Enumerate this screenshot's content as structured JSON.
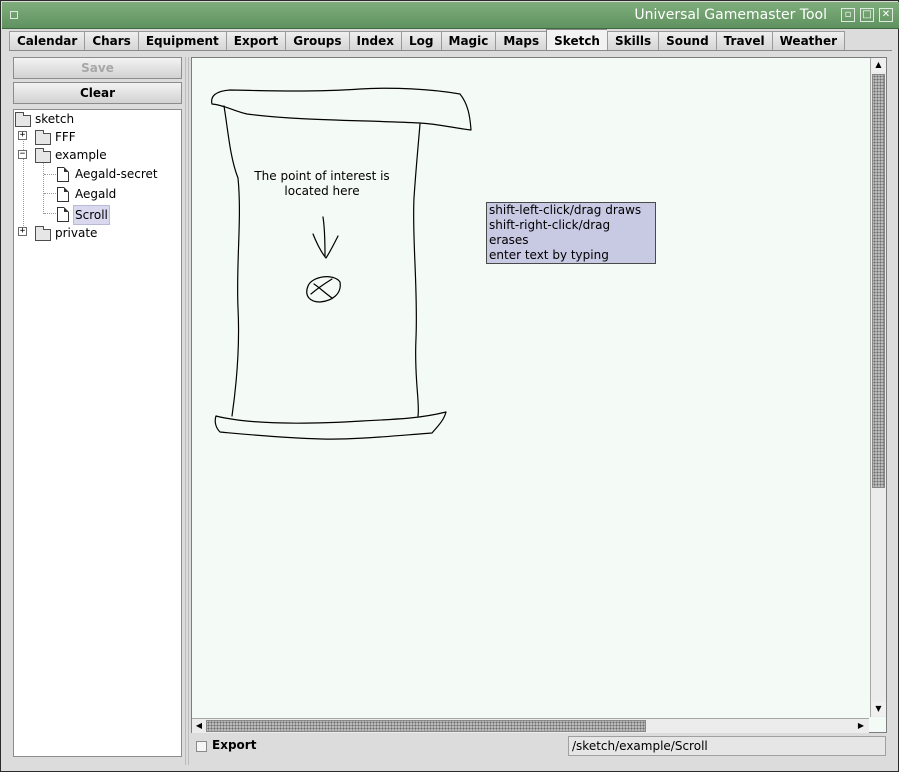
{
  "window": {
    "title": "Universal Gamemaster Tool",
    "title_bar_color": "#6fa06d"
  },
  "tabs": [
    {
      "label": "Calendar"
    },
    {
      "label": "Chars"
    },
    {
      "label": "Equipment"
    },
    {
      "label": "Export"
    },
    {
      "label": "Groups"
    },
    {
      "label": "Index"
    },
    {
      "label": "Log"
    },
    {
      "label": "Magic"
    },
    {
      "label": "Maps"
    },
    {
      "label": "Sketch",
      "active": true
    },
    {
      "label": "Skills"
    },
    {
      "label": "Sound"
    },
    {
      "label": "Travel"
    },
    {
      "label": "Weather"
    }
  ],
  "sidebar": {
    "save_label": "Save",
    "clear_label": "Clear",
    "tree": {
      "root": "sketch",
      "fff": "FFF",
      "example": "example",
      "aegald_secret": "Aegald-secret",
      "aegald": "Aegald",
      "scroll": "Scroll",
      "private": "private"
    }
  },
  "canvas": {
    "sketch_text_line1": "The point of interest is",
    "sketch_text_line2": "located here",
    "help_lines": {
      "draw": "shift-left-click/drag draws",
      "erase": "shift-right-click/drag erases",
      "type": "enter text by typing"
    },
    "background_color": "#f4faf6"
  },
  "footer": {
    "export_label": "Export",
    "export_checked": false,
    "path": "/sketch/example/Scroll"
  }
}
